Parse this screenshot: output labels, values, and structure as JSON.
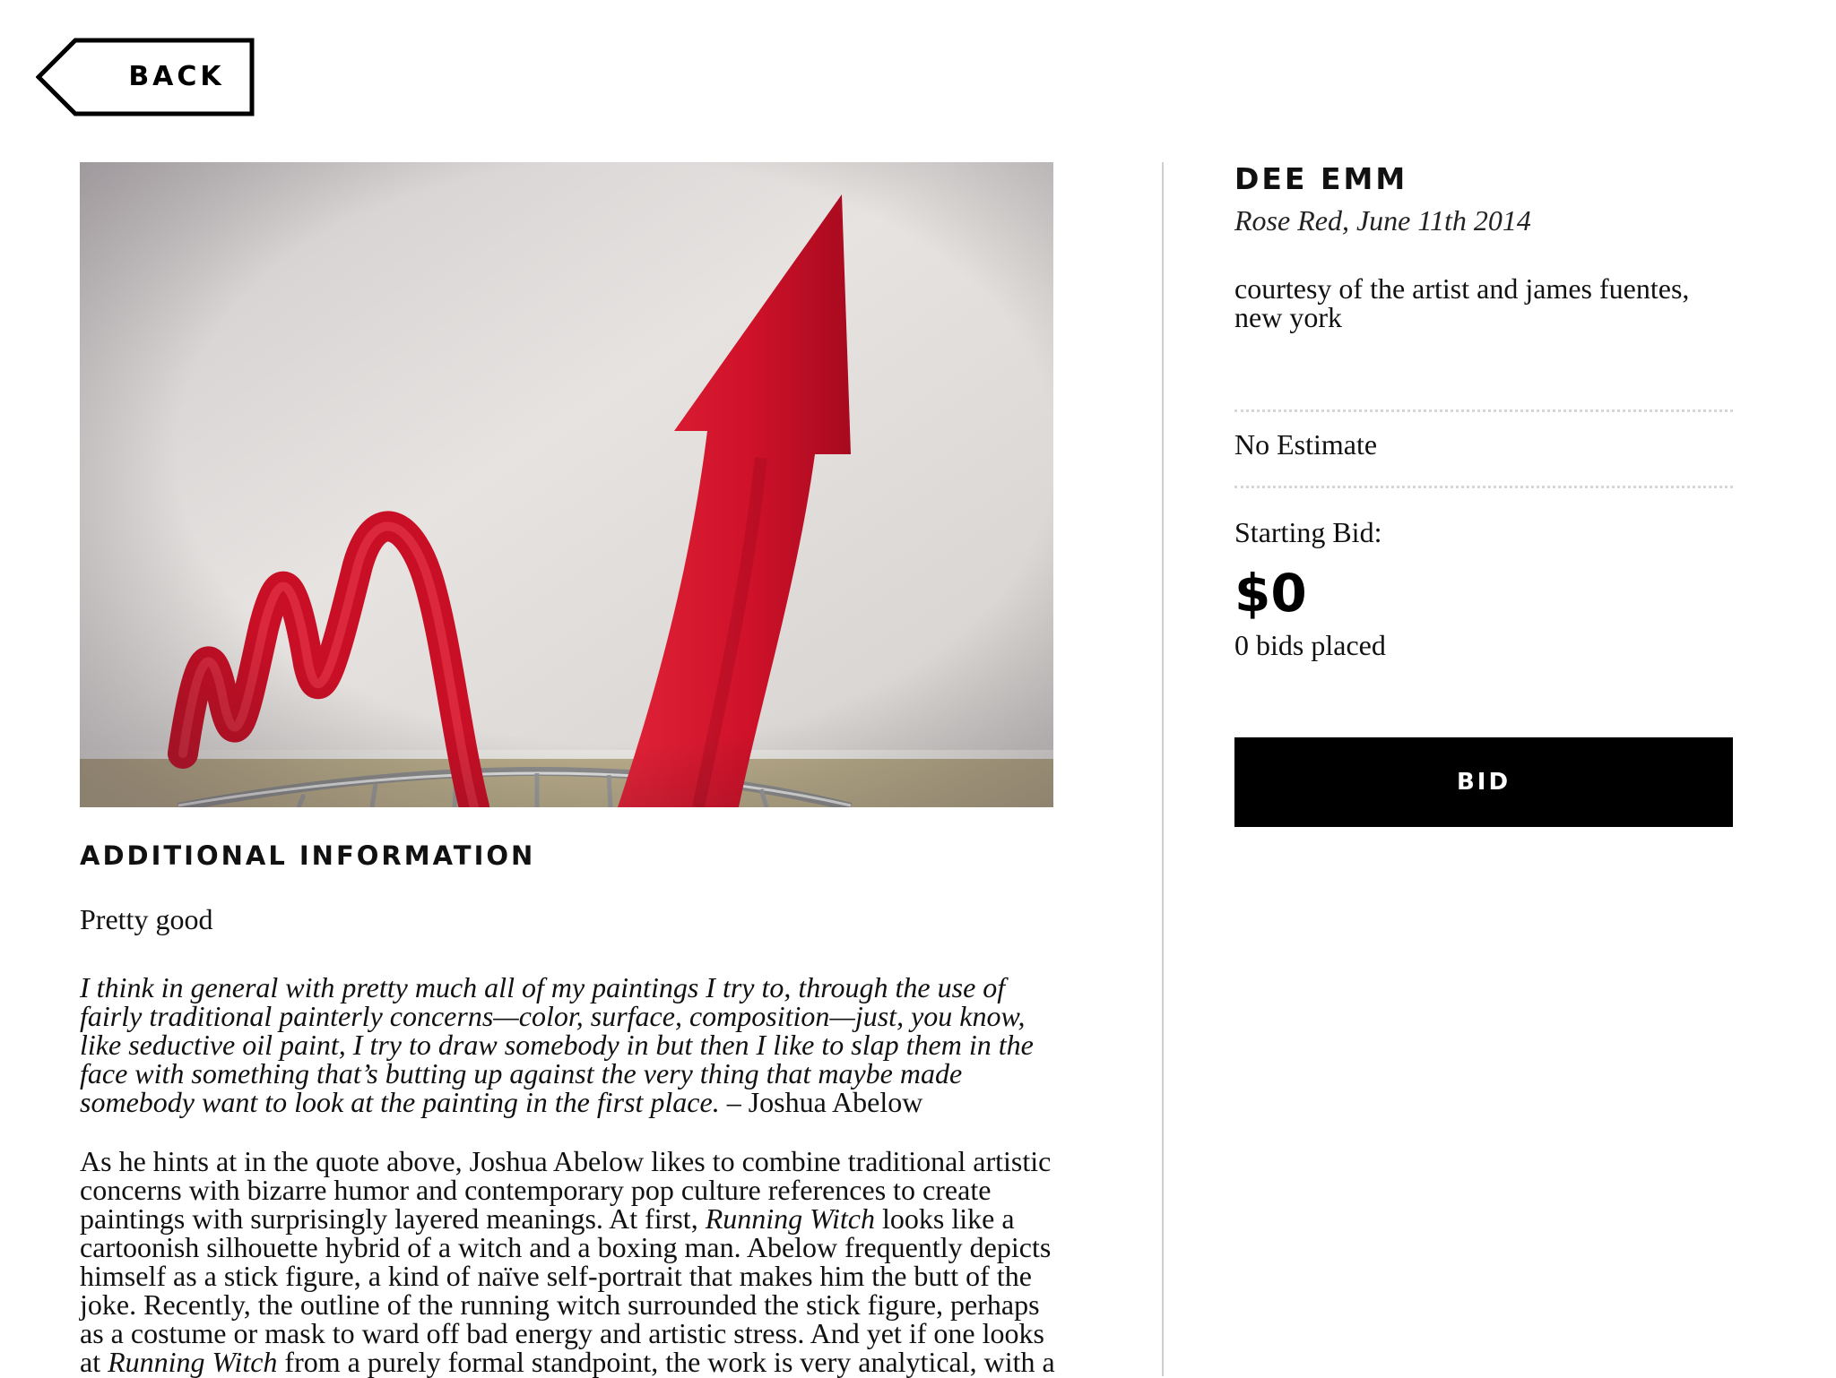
{
  "nav": {
    "back_label": "BACK",
    "back_icon": "back-arrow-tag-icon"
  },
  "artwork": {
    "image_alt": "artwork-image",
    "colors": {
      "arrow": "#d8142c",
      "wall": "#dcd8d6",
      "floor": "#b3a685"
    }
  },
  "info": {
    "heading": "ADDITIONAL INFORMATION",
    "summary": "Pretty good",
    "quote_text": "I think in general with pretty much all of my paintings I try to, through the use of fairly traditional painterly concerns—color, surface, composition—just, you know, like seductive oil paint, I try to draw somebody in but then I like to slap them in the face with something that’s butting up against the very thing that maybe made somebody want to look at the painting in the first place.",
    "quote_attribution": " – Joshua Abelow",
    "body_part1": "As he hints at in the quote above, Joshua Abelow likes to combine traditional artistic concerns with bizarre humor and contemporary pop culture references to create paintings with surprisingly layered meanings. At first, ",
    "body_em1": "Running Witch",
    "body_part2": " looks like a cartoonish silhouette hybrid of a witch and a boxing man. Abelow frequently depicts himself as a stick figure, a kind of naïve self-portrait that makes him the butt of the joke. Recently, the outline of the running witch surrounded the stick figure, perhaps as a costume or mask to ward off bad energy and artistic stress. And yet if one looks at ",
    "body_em2": "Running Witch",
    "body_part3": " from a purely formal standpoint, the work is very analytical, with a"
  },
  "lot": {
    "artist": "DEE EMM",
    "title": "Rose Red, June 11th 2014",
    "credit": "courtesy of the artist and james fuentes, new york",
    "estimate": "No Estimate",
    "starting_bid_label": "Starting Bid:",
    "starting_bid_amount": "$0",
    "bids_placed": "0 bids placed",
    "bid_button_label": "BID"
  }
}
